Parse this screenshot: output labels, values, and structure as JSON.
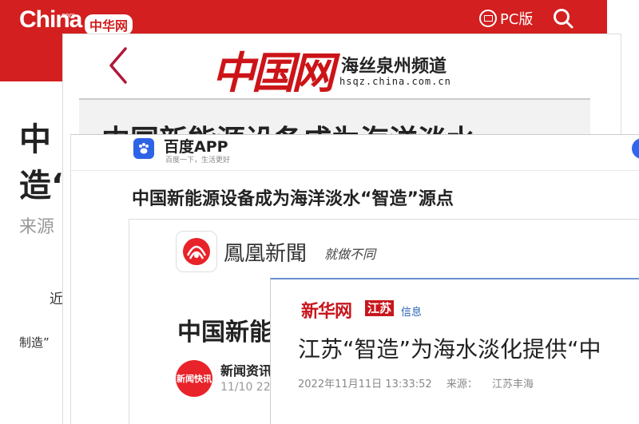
{
  "chinacom": {
    "logo_text": "China",
    "logo_com": "com",
    "badge": "中华网",
    "pc_label": "PC版",
    "title": "中国新能源设备成为海洋淡水“智造”源点",
    "title_visible_line1": "中",
    "title_visible_line2": "造“",
    "source_prefix": "来源",
    "para1_fragment": "近",
    "para2_fragment": "制造”",
    "brand_color": "#d31f1f"
  },
  "hsqz": {
    "logo_big": "中国网",
    "channel_name": "海丝泉州频道",
    "url": "hsqz.china.com.cn",
    "title_fragment": "中国新能源设备成为海洋淡水",
    "brand_color": "#cc1418"
  },
  "baidu": {
    "app_name": "百度APP",
    "slogan": "百度一下，生活更好",
    "article_title": "中国新能源设备成为海洋淡水“智造”源点",
    "brand_color": "#2d63e6"
  },
  "ifeng": {
    "name": "鳳凰新聞",
    "slogan": "就做不同",
    "title_fragment": "中国新能",
    "source_logo_text": "新闻快讯",
    "source_name_fragment": "新闻资讯",
    "source_date_fragment": "11/10 22"
  },
  "xinhua": {
    "logo": "新华网",
    "region_tag": "江苏",
    "section": "信息",
    "title": "江苏“智造”为海水淡化提供“中",
    "date": "2022年11月11日 13:33:52",
    "source_label": "来源：",
    "source_value": "江苏丰海",
    "brand_color": "#c8161d"
  }
}
